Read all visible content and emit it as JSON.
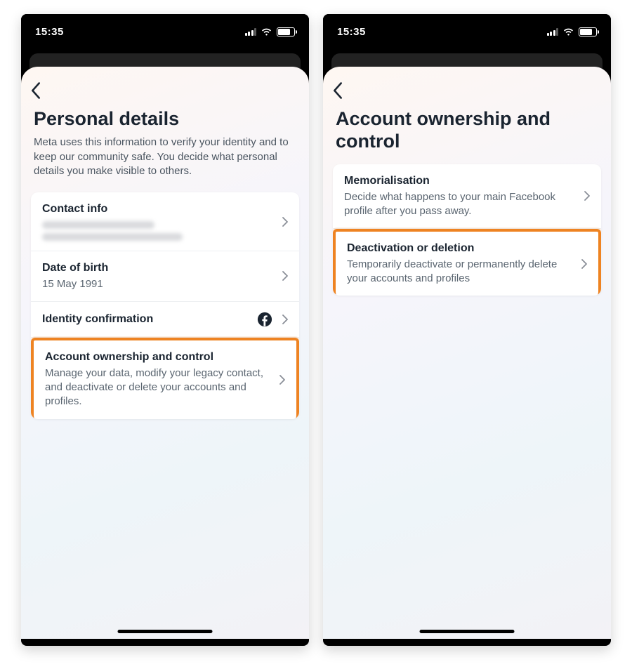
{
  "statusbar": {
    "time": "15:35"
  },
  "left": {
    "title": "Personal details",
    "desc": "Meta uses this information to verify your identity and to keep our community safe. You decide what personal details you make visible to others.",
    "rows": {
      "contact": {
        "title": "Contact info"
      },
      "dob": {
        "title": "Date of birth",
        "value": "15 May 1991"
      },
      "identity": {
        "title": "Identity confirmation"
      },
      "ownership": {
        "title": "Account ownership and control",
        "sub": "Manage your data, modify your legacy contact, and deactivate or delete your accounts and profiles."
      }
    }
  },
  "right": {
    "title": "Account ownership and control",
    "rows": {
      "memorial": {
        "title": "Memorialisation",
        "sub": "Decide what happens to your main Facebook profile after you pass away."
      },
      "deactivate": {
        "title": "Deactivation or deletion",
        "sub": "Temporarily deactivate or permanently delete your accounts and profiles"
      }
    }
  }
}
